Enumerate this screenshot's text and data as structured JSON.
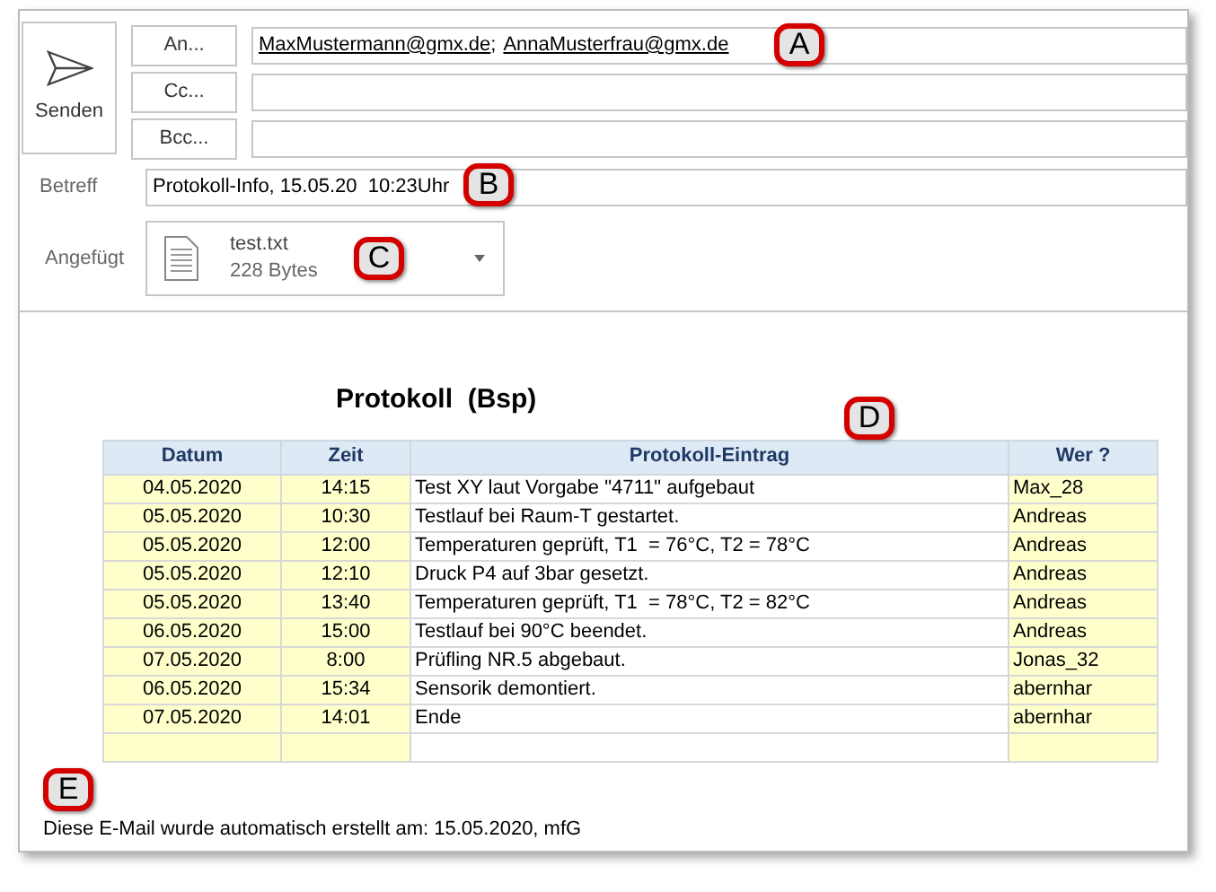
{
  "send_button": {
    "label": "Senden"
  },
  "recipients": [
    {
      "button": "An...",
      "addresses": [
        "MaxMustermann@gmx.de",
        "AnnaMusterfrau@gmx.de"
      ],
      "separator": ";",
      "callout": "A"
    },
    {
      "button": "Cc..."
    },
    {
      "button": "Bcc..."
    }
  ],
  "subject": {
    "label": "Betreff",
    "value": "Protokoll-Info, 15.05.20  10:23Uhr",
    "callout": "B"
  },
  "attachment": {
    "label": "Angefügt",
    "file_name": "test.txt",
    "size": "228 Bytes",
    "callout": "C"
  },
  "body": {
    "title": "Protokoll  (Bsp)",
    "table": {
      "callout": "D",
      "columns": [
        "Datum",
        "Zeit",
        "Protokoll-Eintrag",
        "Wer ?"
      ],
      "rows": [
        [
          "04.05.2020",
          "14:15",
          "Test XY laut Vorgabe \"4711\" aufgebaut",
          "Max_28"
        ],
        [
          "05.05.2020",
          "10:30",
          "Testlauf bei Raum-T gestartet.",
          "Andreas"
        ],
        [
          "05.05.2020",
          "12:00",
          "Temperaturen geprüft, T1  = 76°C, T2 = 78°C",
          "Andreas"
        ],
        [
          "05.05.2020",
          "12:10",
          "Druck P4 auf 3bar gesetzt.",
          "Andreas"
        ],
        [
          "05.05.2020",
          "13:40",
          "Temperaturen geprüft, T1  = 78°C, T2 = 82°C",
          "Andreas"
        ],
        [
          "06.05.2020",
          "15:00",
          "Testlauf bei 90°C beendet.",
          "Andreas"
        ],
        [
          "07.05.2020",
          "8:00",
          "Prüfling NR.5 abgebaut.",
          "Jonas_32"
        ],
        [
          "06.05.2020",
          "15:34",
          "Sensorik demontiert.",
          "abernhar"
        ],
        [
          "07.05.2020",
          "14:01",
          "Ende",
          "abernhar"
        ]
      ]
    },
    "footer": {
      "callout": "E",
      "text": "Diese E-Mail wurde automatisch erstellt am: 15.05.2020, mfG"
    }
  }
}
